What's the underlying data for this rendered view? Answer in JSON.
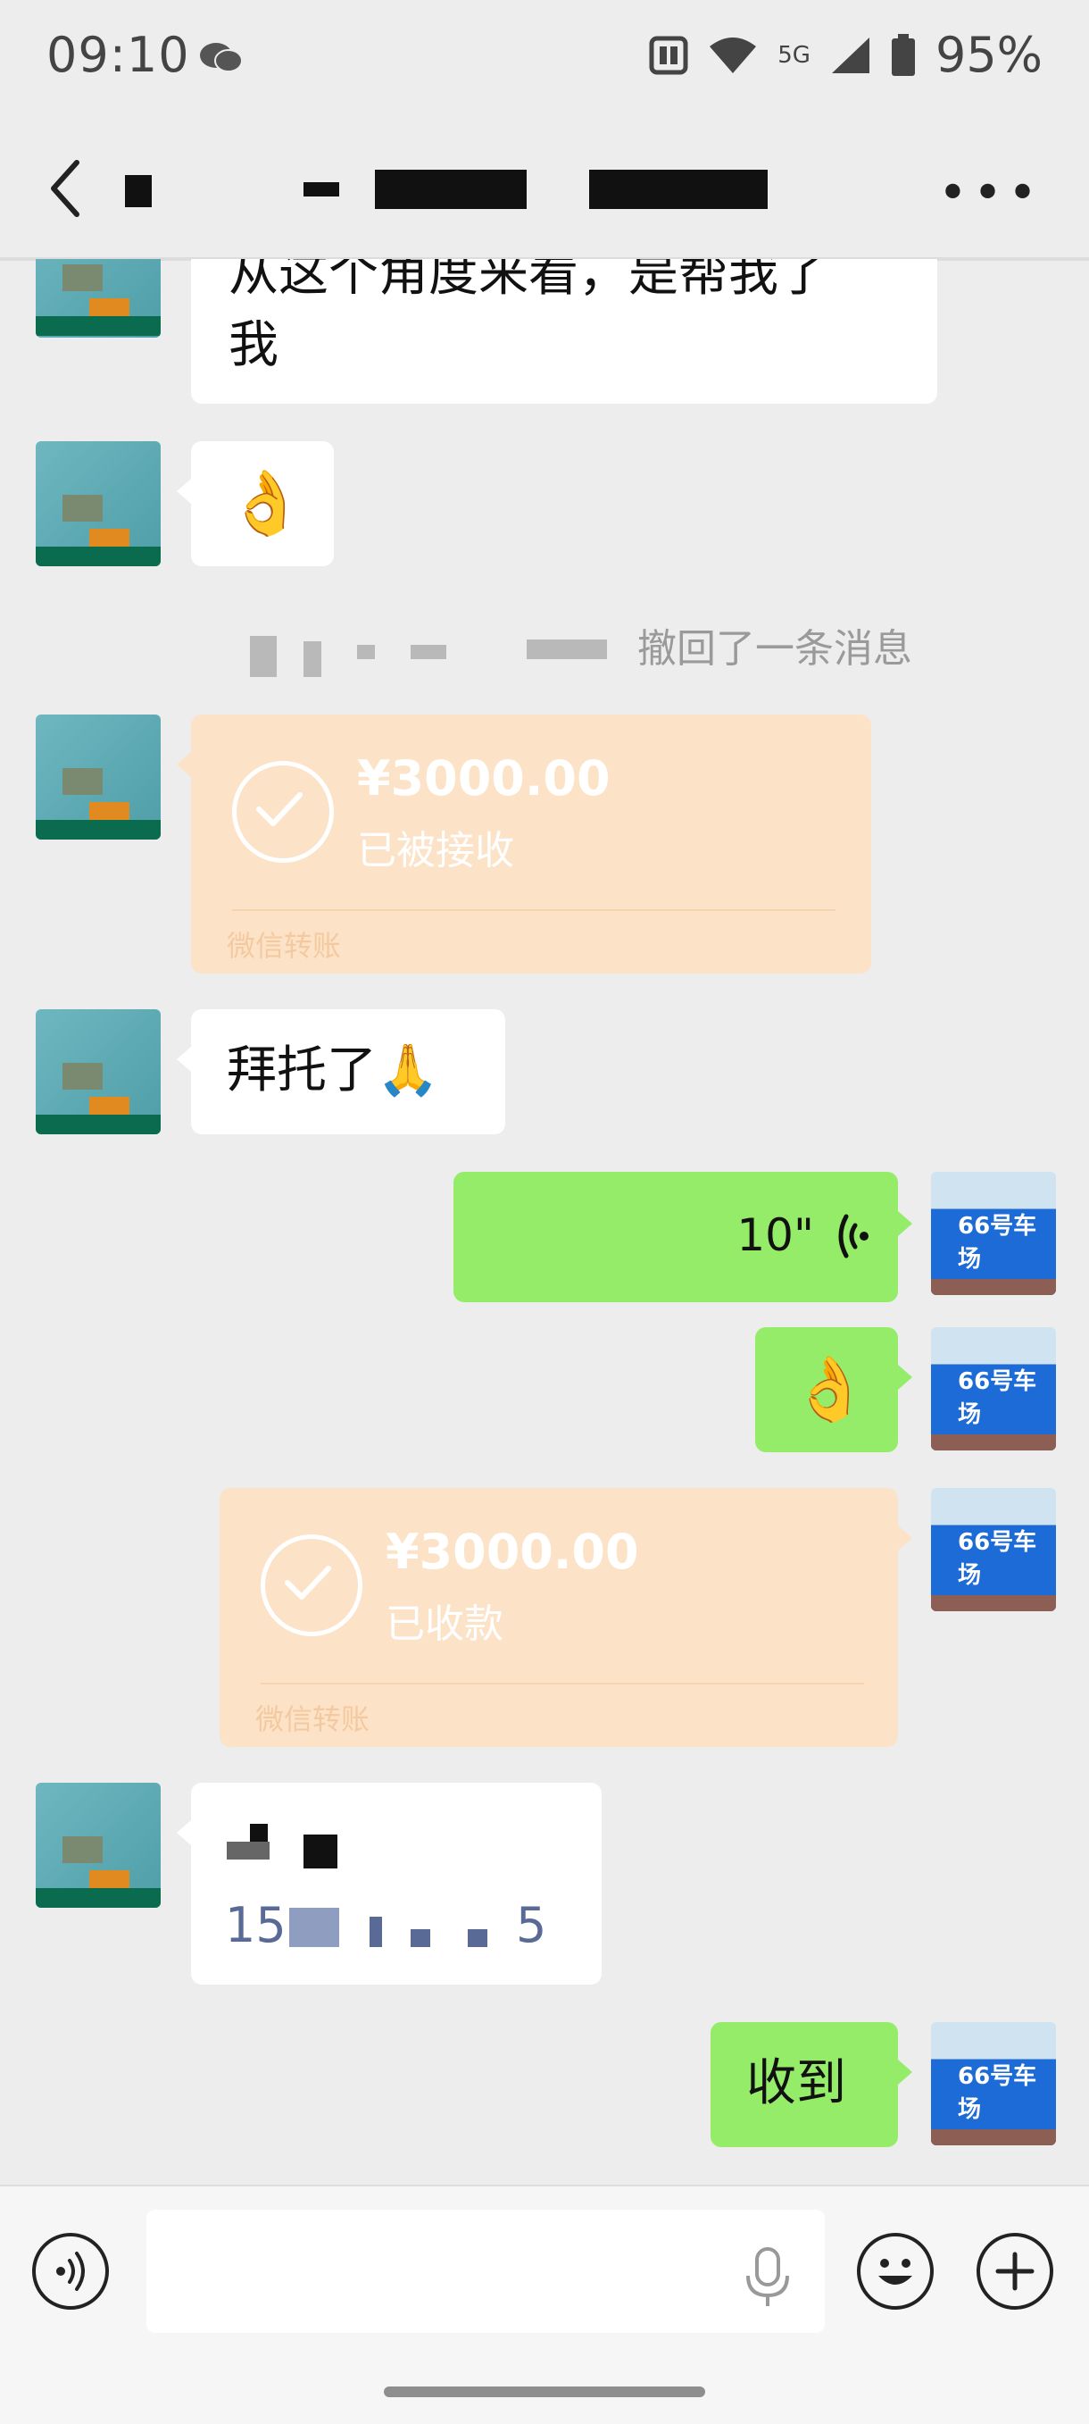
{
  "status_bar": {
    "time": "09:10",
    "network_label": "5G",
    "battery": "95%",
    "icons": [
      "wechat-icon",
      "nfc-icon",
      "wifi-icon",
      "signal-icon",
      "battery-icon"
    ]
  },
  "header": {
    "back_icon": "chevron-left-icon",
    "more_icon": "more-dots-icon"
  },
  "messages": {
    "m1_text_line1": "从这个角度来看，是帮我了",
    "m1_text_line2": "我",
    "m2_emoji": "👌",
    "recall_text": "撤回了一条消息",
    "t1_amount": "¥3000.00",
    "t1_status": "已被接收",
    "t1_brand": "微信转账",
    "m3_text": "拜托了🙏",
    "voice_duration": "10\"",
    "m4_emoji": "👌",
    "t2_amount": "¥3000.00",
    "t2_status": "已收款",
    "t2_brand": "微信转账",
    "contact_line2": "15",
    "contact_line2_end": "5",
    "m_last": "收到"
  },
  "avatars": {
    "right_label": "66号车场"
  },
  "inputbar": {
    "voice_icon": "voice-toggle-icon",
    "mic_icon": "microphone-icon",
    "emoji_icon": "emoji-icon",
    "plus_icon": "plus-icon"
  }
}
